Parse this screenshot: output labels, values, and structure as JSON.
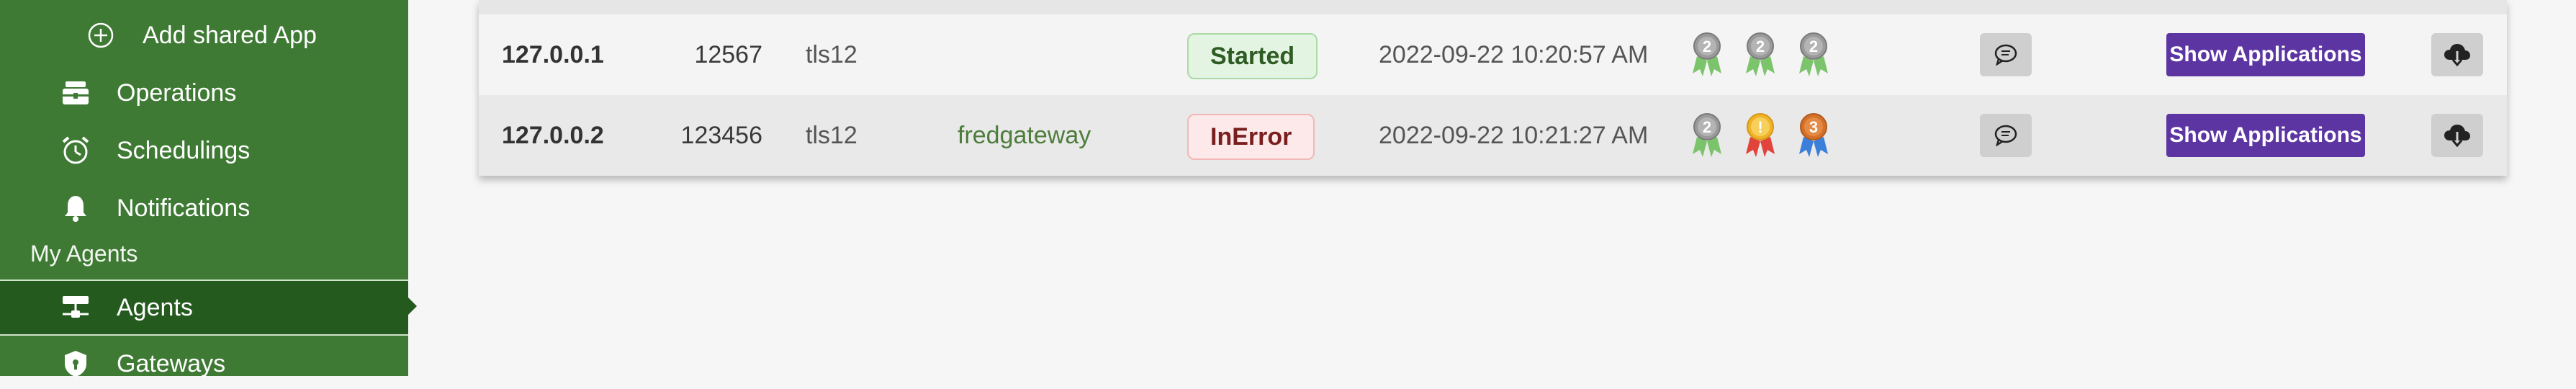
{
  "sidebar": {
    "items": [
      {
        "label": "Add shared App",
        "icon": "plus-circle-icon"
      },
      {
        "label": "Operations",
        "icon": "toolbox-icon"
      },
      {
        "label": "Schedulings",
        "icon": "alarm-clock-icon"
      },
      {
        "label": "Notifications",
        "icon": "bell-icon"
      }
    ],
    "section": "My Agents",
    "agents_label": "Agents",
    "gateways_label": "Gateways"
  },
  "table": {
    "rows": [
      {
        "ip": "127.0.0.1",
        "port": "12567",
        "protocol": "tls12",
        "gateway": "",
        "status": "Started",
        "date": "2022-09-22 10:20:57 AM",
        "medals": [
          "2",
          "2",
          "2"
        ],
        "apps_label": "Show Applications"
      },
      {
        "ip": "127.0.0.2",
        "port": "123456",
        "protocol": "tls12",
        "gateway": "fredgateway",
        "status": "InError",
        "date": "2022-09-22 10:21:27 AM",
        "medals": [
          "2",
          "!",
          "3"
        ],
        "apps_label": "Show Applications"
      }
    ]
  },
  "colors": {
    "sidebar": "#3f7a35",
    "sidebar_active": "#255a1f",
    "button": "#5c35a3"
  }
}
